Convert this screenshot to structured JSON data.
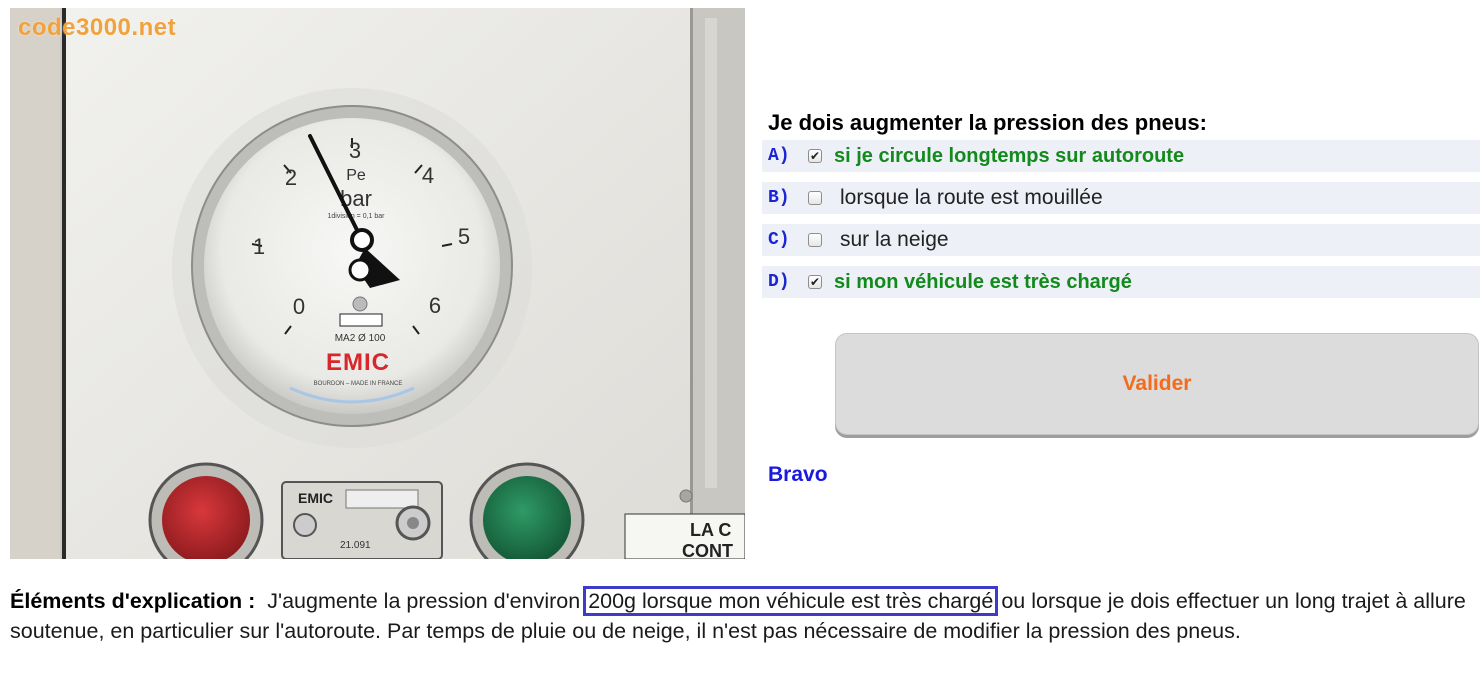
{
  "photo": {
    "watermark": "code3000.net",
    "gauge": {
      "dial_numbers": [
        "0",
        "1",
        "2",
        "3",
        "4",
        "5",
        "6"
      ],
      "unit_symbol": "Pe",
      "unit": "bar",
      "division_note": "1division = 0,1 bar",
      "model": "MA2 Ø 100",
      "brand": "EMIC",
      "made_in": "BOURDON – MADE IN FRANCE"
    },
    "control_plate": {
      "brand": "EMIC",
      "code": "21.091"
    },
    "panel_label": [
      "LA C",
      "CONT"
    ],
    "colors": {
      "red_button": "#b8262b",
      "green_button": "#1f7a4f",
      "brand_red": "#d8262a"
    }
  },
  "question": "Je dois augmenter la pression des pneus:",
  "answers": [
    {
      "letter": "A)",
      "text": "si je circule longtemps sur autoroute",
      "checked": true,
      "correct": true
    },
    {
      "letter": "B)",
      "text": "lorsque la route est mouillée",
      "checked": false,
      "correct": false
    },
    {
      "letter": "C)",
      "text": "sur la neige",
      "checked": false,
      "correct": false
    },
    {
      "letter": "D)",
      "text": "si mon véhicule est très chargé",
      "checked": true,
      "correct": true
    }
  ],
  "validate_label": "Valider",
  "result": "Bravo",
  "explanation": {
    "lead": "Éléments d'explication :",
    "before": "J'augmente la pression d'environ",
    "highlight": "200g lorsque mon véhicule est très chargé",
    "after": "ou lorsque je dois effectuer un long trajet à allure soutenue, en particulier sur l'autoroute. Par temps de pluie ou de neige, il n'est pas nécessaire de modifier la pression des pneus."
  },
  "colors": {
    "answer_letter": "#1a25d4",
    "correct_text": "#138a1c",
    "button_text": "#f36b1b",
    "result_text": "#1a1adf",
    "highlight_border": "#3c3cc8"
  }
}
